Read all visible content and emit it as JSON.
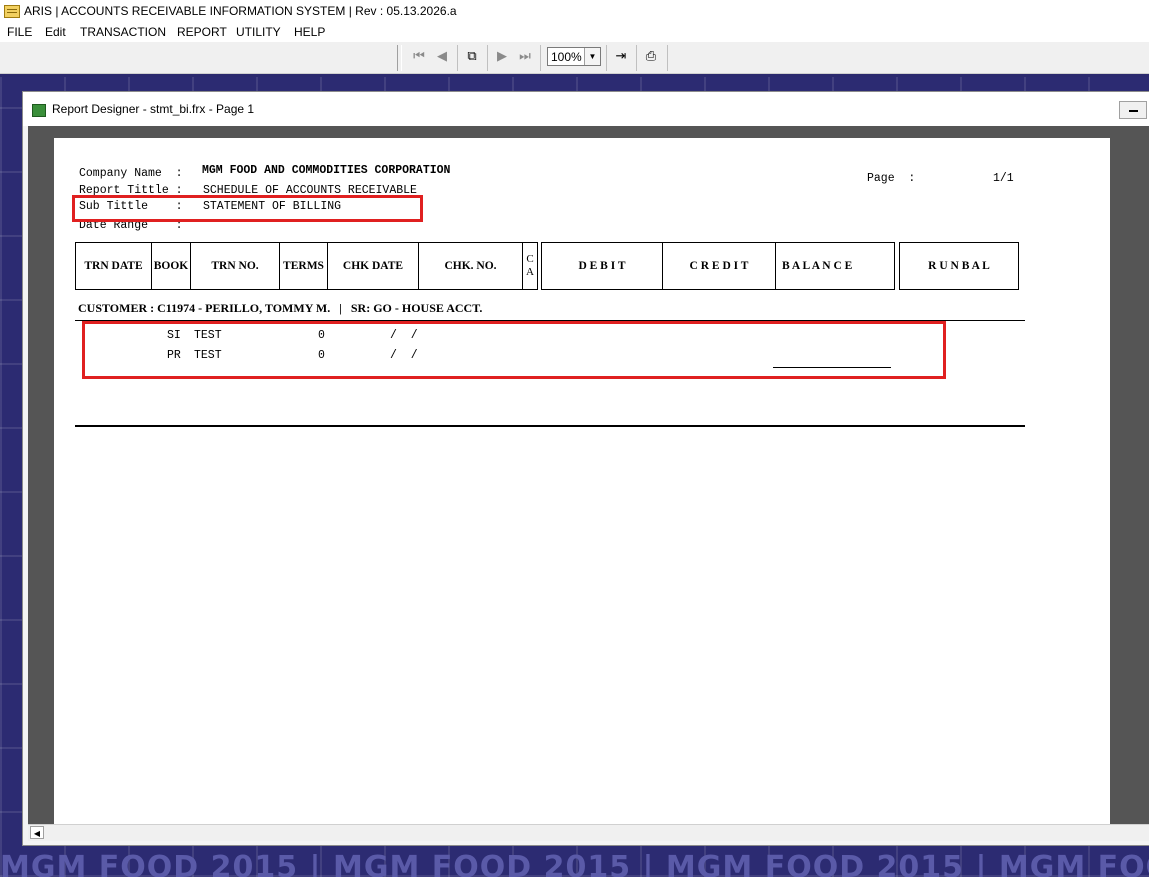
{
  "window": {
    "title": "ARIS | ACCOUNTS RECEIVABLE INFORMATION SYSTEM |  Rev : 05.13.2026.a"
  },
  "menu": [
    "FILE",
    "Edit",
    "TRANSACTION",
    "REPORT",
    "UTILITY",
    "HELP"
  ],
  "toolbar": {
    "zoom": "100%",
    "icons": [
      "first-page-icon",
      "previous-page-icon",
      "multi-page-icon",
      "next-page-icon",
      "last-page-icon",
      "close-preview-icon",
      "print-icon"
    ]
  },
  "child_window": {
    "title": "Report Designer - stmt_bi.frx - Page 1"
  },
  "report": {
    "company_label": "Company Name  :",
    "company_value": "MGM FOOD AND COMMODITIES CORPORATION",
    "report_title_label": "Report Tittle :",
    "report_title_value": "SCHEDULE OF ACCOUNTS RECEIVABLE",
    "sub_title_label": "Sub Tittle    :",
    "sub_title_value": "STATEMENT OF BILLING",
    "date_range_label": "Date Range    :",
    "page_label": "Page  :",
    "page_value": "1/1",
    "columns": [
      "TRN DATE",
      "BOOK",
      "TRN NO.",
      "TERMS",
      "CHK DATE",
      "CHK. NO.",
      "C\nA",
      "D E B I T",
      "C R E D I T",
      "B A L A N C E",
      "R U N B A L"
    ],
    "customer_line": "CUSTOMER : C11974 - PERILLO, TOMMY M.   |   SR: GO - HOUSE ACCT.",
    "rows": [
      {
        "book": "SI",
        "trn_no": "TEST",
        "terms": "0",
        "chk_date": "/  /"
      },
      {
        "book": "PR",
        "trn_no": "TEST",
        "terms": "0",
        "chk_date": "/  /"
      }
    ]
  },
  "watermark": "MGM FOOD 2015 | MGM FOOD 2015 | MGM FOOD 2015 | MGM FOOD 2015 | MGM FOOD"
}
